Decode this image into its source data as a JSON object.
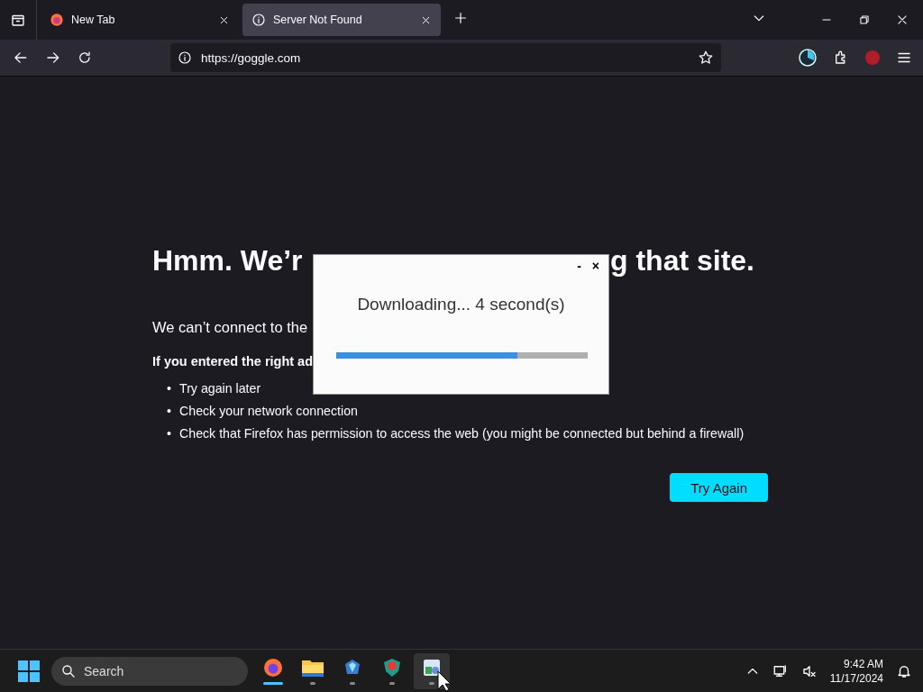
{
  "tabs": [
    {
      "label": "New Tab",
      "kind": "firefox",
      "selected": false
    },
    {
      "label": "Server Not Found",
      "kind": "info",
      "selected": true
    }
  ],
  "address_bar": {
    "value": "https://goggle.com"
  },
  "error_page": {
    "heading_visible_parts": [
      "Hmm. We’r",
      "g that site."
    ],
    "lines": [
      "We can’t connect to the",
      "If you entered the right ad"
    ],
    "bullets": [
      {
        "marker": "•",
        "text": "Try again later"
      },
      {
        "marker": "•",
        "text": "Check your network connection"
      },
      {
        "marker": "•",
        "text": "Check that Firefox has permission to access the web (you might be connected but behind a firewall)"
      }
    ],
    "button": "Try Again"
  },
  "dialog": {
    "minimize": "-",
    "close": "×",
    "message": "Downloading... 4 second(s)",
    "level": 0.72
  },
  "taskbar": {
    "search_placeholder": "Search",
    "apps": [
      {
        "kind": "firefox",
        "selected": true,
        "hovered": false
      },
      {
        "kind": "folder",
        "selected": false,
        "hovered": false
      },
      {
        "kind": "gem",
        "selected": false,
        "hovered": false
      },
      {
        "kind": "shield",
        "selected": false,
        "hovered": false
      },
      {
        "kind": "installer",
        "selected": false,
        "hovered": true
      }
    ],
    "time": "9:42 AM",
    "date": "11/17/2024"
  }
}
